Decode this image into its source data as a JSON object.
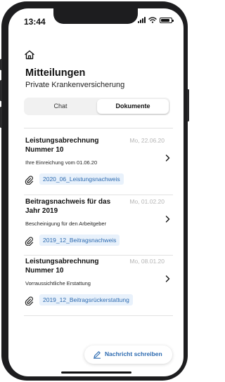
{
  "status_bar": {
    "time": "13:44"
  },
  "header": {
    "title": "Mitteilungen",
    "subtitle": "Private Krankenversicherung"
  },
  "tabs": [
    {
      "label": "Chat",
      "selected": false
    },
    {
      "label": "Dokumente",
      "selected": true
    }
  ],
  "documents": [
    {
      "title": "Leistungsabrechnung Nummer 10",
      "date": "Mo, 22.06.20",
      "description": "Ihre Einreichung vom 01.06.20",
      "attachment": "2020_06_Leistungsnachweis"
    },
    {
      "title": "Beitragsnachweis für das Jahr 2019",
      "date": "Mo, 01.02.20",
      "description": "Bescheinigung für den Arbeitgeber",
      "attachment": "2019_12_Beitragsnachweis"
    },
    {
      "title": "Leistungsabrechnung Nummer 10",
      "date": "Mo, 08.01.20",
      "description": "Vorraussichtliche Erstattung",
      "attachment": "2019_12_Beitragsrückerstattung"
    }
  ],
  "compose_button": {
    "label": "Nachricht schreiben"
  },
  "icons": {
    "home": "home-icon",
    "paperclip": "paperclip-icon",
    "chevron": "chevron-right-icon",
    "pencil": "pencil-icon"
  },
  "colors": {
    "accent": "#2c6ab0",
    "attachment_bg": "#e8f1fb",
    "date": "#b5b5b5",
    "frame": "#1d1d1f"
  }
}
